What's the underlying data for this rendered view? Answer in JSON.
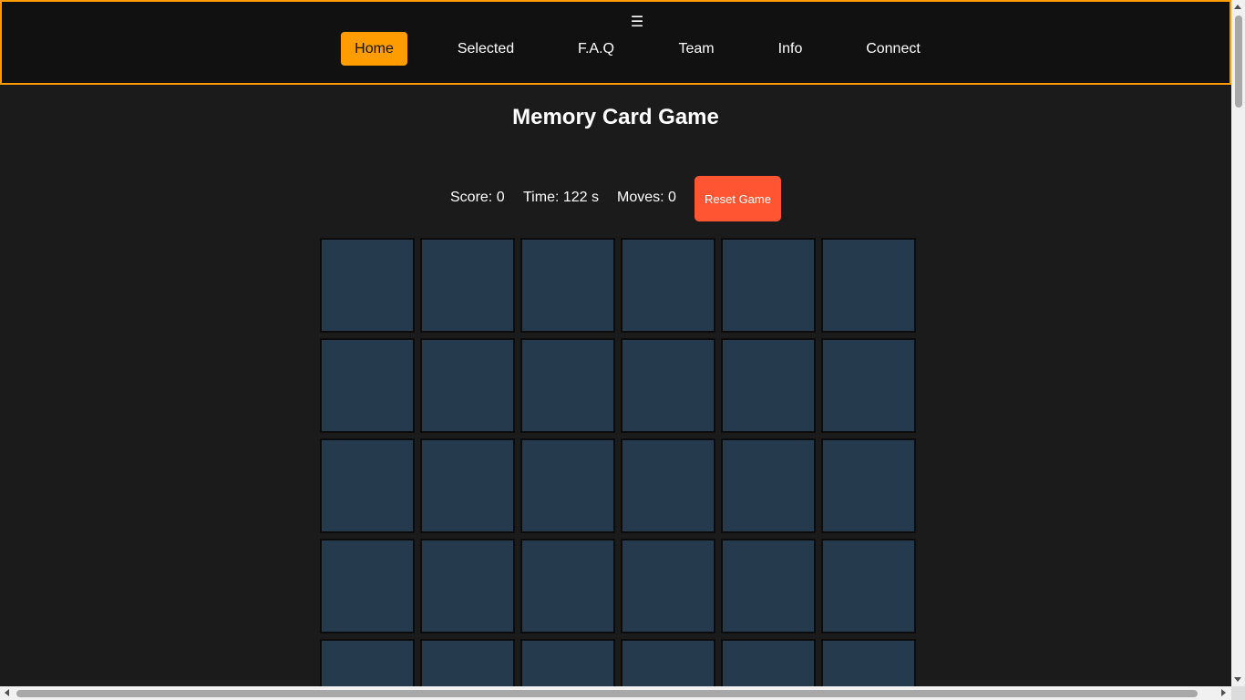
{
  "nav": {
    "menu_icon": "hamburger-icon",
    "menu_glyph": "☰",
    "items": [
      {
        "label": "Home",
        "active": true
      },
      {
        "label": "Selected",
        "active": false
      },
      {
        "label": "F.A.Q",
        "active": false
      },
      {
        "label": "Team",
        "active": false
      },
      {
        "label": "Info",
        "active": false
      },
      {
        "label": "Connect",
        "active": false
      }
    ]
  },
  "game": {
    "title": "Memory Card Game",
    "score_text": "Score: 0",
    "time_text": "Time: 122 s",
    "moves_text": "Moves: 0",
    "reset_label": "Reset Game",
    "score": 0,
    "time_seconds": 122,
    "moves": 0,
    "grid_columns": 6,
    "visible_rows": 5,
    "card_state": "face-down"
  },
  "colors": {
    "accent": "#ff9d00",
    "reset_button": "#ff5533",
    "card_back": "#263a4d",
    "background": "#1b1b1b",
    "nav_background": "#111111"
  }
}
